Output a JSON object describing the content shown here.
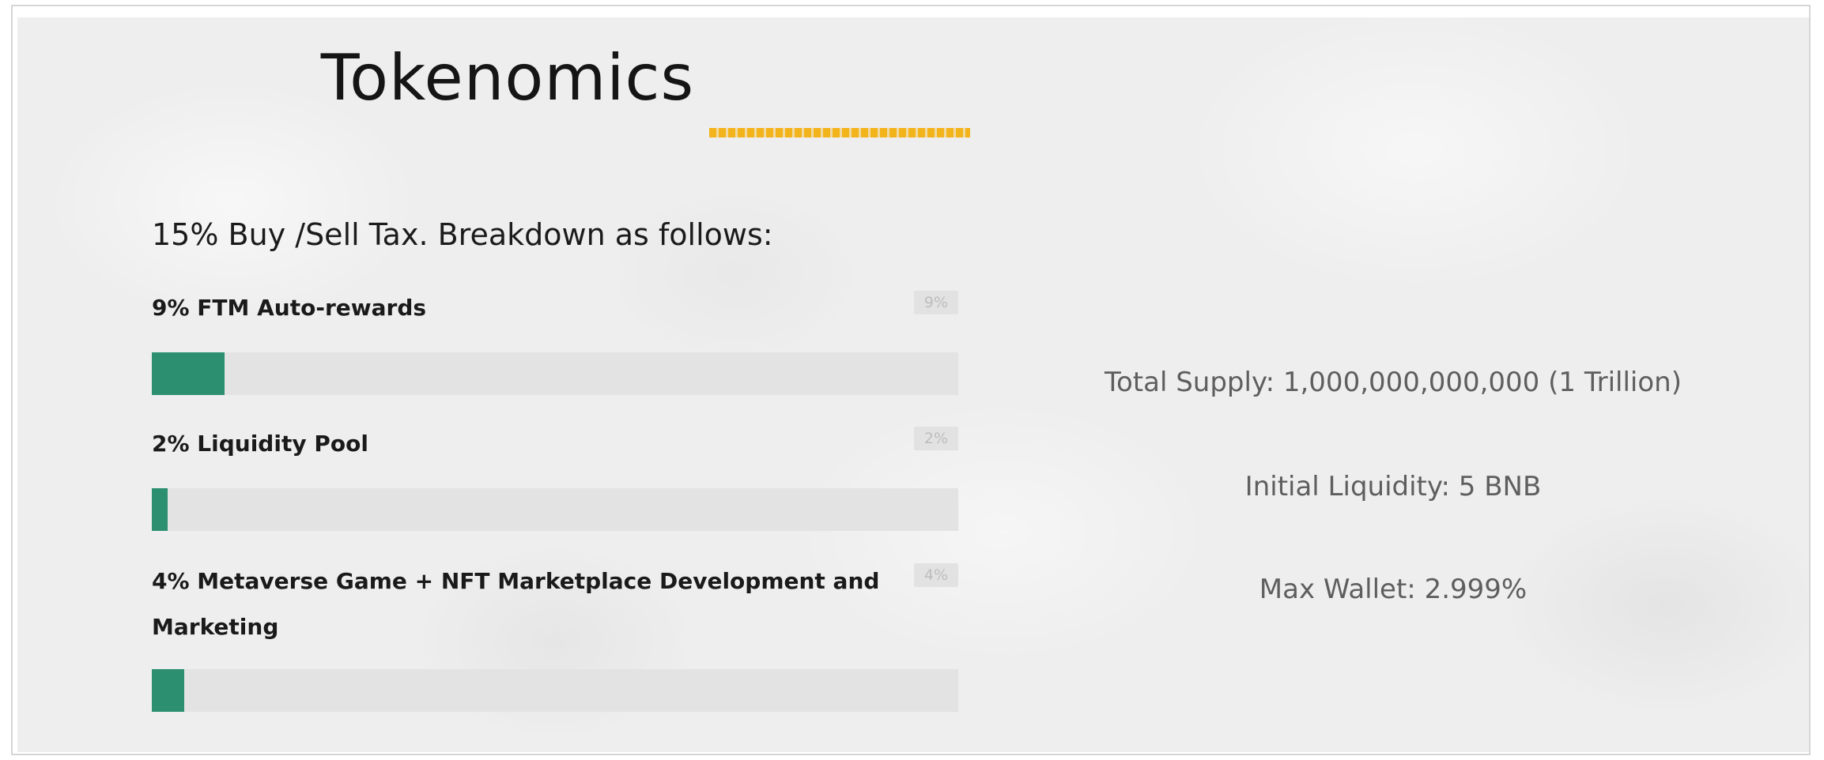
{
  "section": {
    "title": "Tokenomics",
    "subtitle": "15% Buy /Sell Tax. Breakdown as follows:"
  },
  "tax_breakdown": [
    {
      "label": "9% FTM Auto-rewards",
      "badge": "9%",
      "percent": 9
    },
    {
      "label": "2% Liquidity Pool",
      "badge": "2%",
      "percent": 2
    },
    {
      "label": "4% Metaverse Game + NFT Marketplace Development and Marketing",
      "badge": "4%",
      "percent": 4
    }
  ],
  "info": {
    "total_supply": "Total Supply: 1,000,000,000,000 (1 Trillion)",
    "initial_liquidity": "Initial Liquidity: 5 BNB",
    "max_wallet": "Max Wallet: 2.999%"
  },
  "colors": {
    "accent": "#f3b31b",
    "bar_fill": "#2b8f70",
    "bar_track": "#e3e3e3"
  }
}
